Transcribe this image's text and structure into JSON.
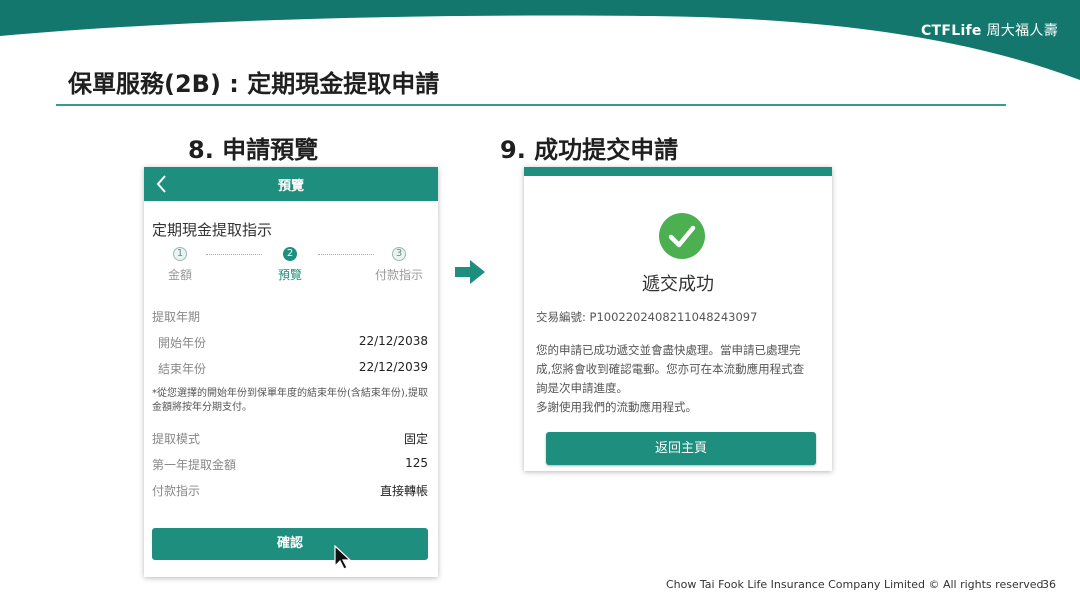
{
  "brand": {
    "ctf": "CTFLife",
    "chinese": "周大福人壽"
  },
  "page_title": "保單服務(2B) : 定期現金提取申請",
  "step8_title": "8. 申請預覽",
  "step9_title": "9. 成功提交申請",
  "preview_screen": {
    "nav_title": "預覽",
    "form_title": "定期現金提取指示",
    "steps": [
      {
        "num": "1",
        "label": "金額"
      },
      {
        "num": "2",
        "label": "預覽"
      },
      {
        "num": "3",
        "label": "付款指示"
      }
    ],
    "section_label": "提取年期",
    "start_label": "開始年份",
    "start_value": "22/12/2038",
    "end_label": "結束年份",
    "end_value": "22/12/2039",
    "note": "*從您選擇的開始年份到保單年度的結束年份(含結束年份),提取金額將按年分期支付。",
    "mode_label": "提取模式",
    "mode_value": "固定",
    "first_amount_label": "第一年提取金額",
    "first_amount_value": "125",
    "payment_label": "付款指示",
    "payment_value": "直接轉帳",
    "confirm_label": "確認"
  },
  "success_screen": {
    "title": "遞交成功",
    "txn_label": "交易編號:",
    "txn_value": "P1002202408211048243097",
    "desc_lines": [
      "您的申請已成功遞交並會盡快處理。當申請已處理完",
      "成,您將會收到確認電郵。您亦可在本流動應用程式查",
      "詢是次申請進度。",
      "多謝使用我們的流動應用程式。"
    ],
    "home_label": "返回主頁"
  },
  "footer": "Chow Tai Fook Life Insurance Company Limited © All rights reserved",
  "page_number": "36",
  "colors": {
    "accent": "#1e8e7f",
    "success": "#4caf50",
    "wave": "#13776d"
  }
}
